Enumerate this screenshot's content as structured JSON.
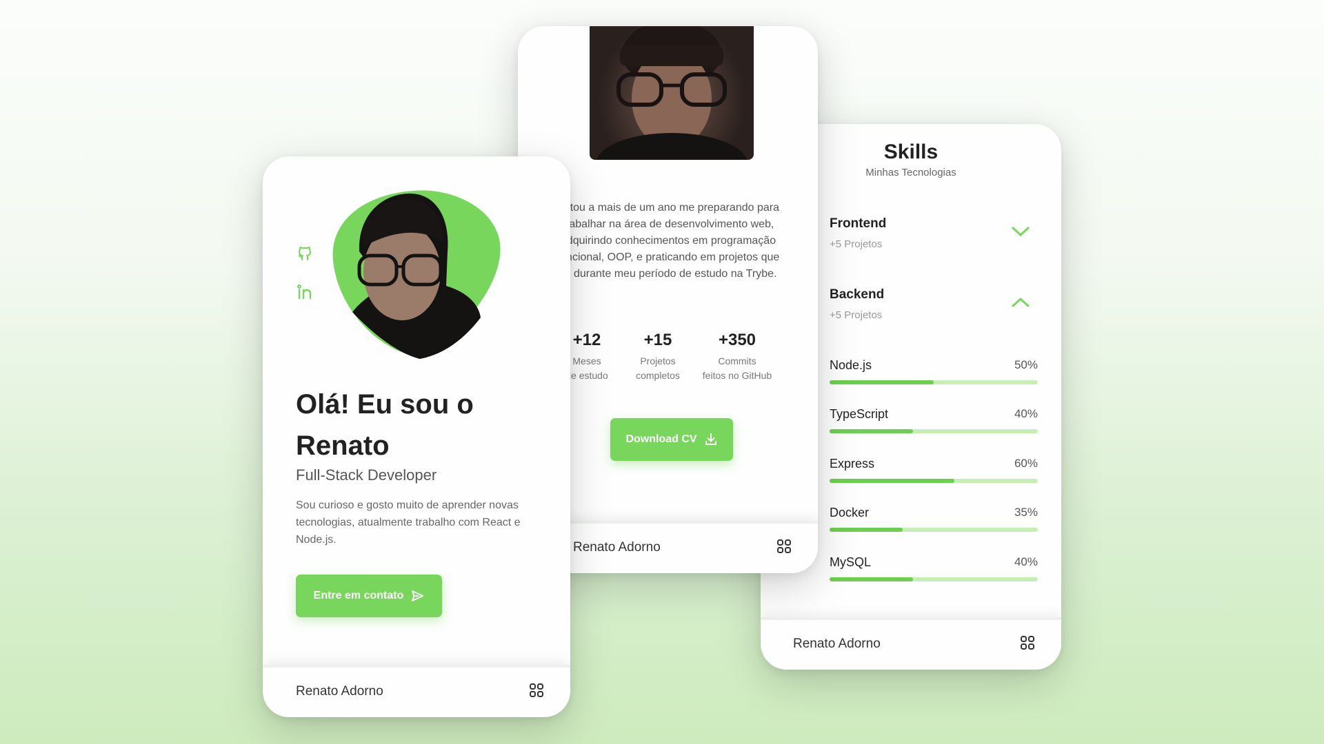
{
  "colors": {
    "accent": "#78d65c",
    "accent_fill": "#6ccf4f",
    "accent_track": "#c6efb6"
  },
  "home": {
    "hello_line1": "Olá! Eu sou o",
    "hello_line2": "Renato",
    "role": "Full-Stack Developer",
    "description": "Sou curioso e gosto muito de aprender novas tecnologias, atualmente trabalho com React e Node.js.",
    "contact_button": "Entre em contato",
    "social_icons": [
      "github-icon",
      "linkedin-icon"
    ],
    "footer_name": "Renato Adorno"
  },
  "about": {
    "text": "Estou a mais de um ano me preparando para trabalhar na área de desenvolvimento web, adquirindo conhecimentos em programação funcional, OOP, e praticando em projetos que fiz durante meu período de estudo na Trybe.",
    "stats": [
      {
        "value": "+12",
        "label1": "Meses",
        "label2": "de estudo"
      },
      {
        "value": "+15",
        "label1": "Projetos",
        "label2": "completos"
      },
      {
        "value": "+350",
        "label1": "Commits",
        "label2": "feitos no GitHub"
      }
    ],
    "download_button": "Download CV",
    "footer_name": "Renato Adorno"
  },
  "skills": {
    "title": "Skills",
    "subtitle": "Minhas Tecnologias",
    "groups": [
      {
        "title": "Frontend",
        "subtitle": "+5 Projetos",
        "state": "collapsed"
      },
      {
        "title": "Backend",
        "subtitle": "+5 Projetos",
        "state": "expanded"
      }
    ],
    "items": [
      {
        "name": "Node.js",
        "percent_label": "50%",
        "value": 0.5
      },
      {
        "name": "TypeScript",
        "percent_label": "40%",
        "value": 0.4
      },
      {
        "name": "Express",
        "percent_label": "60%",
        "value": 0.6
      },
      {
        "name": "Docker",
        "percent_label": "35%",
        "value": 0.35
      },
      {
        "name": "MySQL",
        "percent_label": "40%",
        "value": 0.4
      }
    ],
    "footer_name": "Renato Adorno"
  }
}
